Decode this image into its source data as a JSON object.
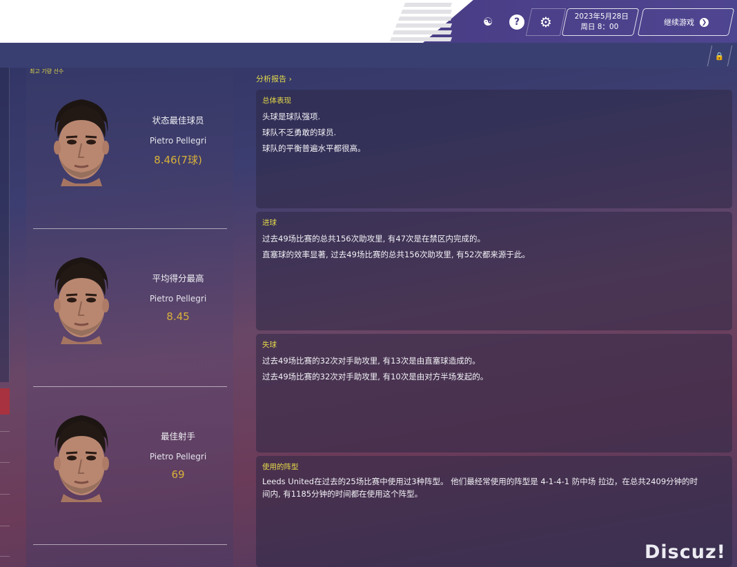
{
  "header": {
    "date": "2023年5月28日",
    "time": "周日 8：00",
    "continue_label": "继续游戏",
    "icons": [
      "globe-icon",
      "help-icon",
      "gear-icon",
      "lock-icon",
      "chevron-right-icon"
    ]
  },
  "players_panel": {
    "title": "최고 기량 선수",
    "cards": [
      {
        "title": "状态最佳球员",
        "name": "Pietro Pellegri",
        "value": "8.46(7球)"
      },
      {
        "title": "平均得分最高",
        "name": "Pietro Pellegri",
        "value": "8.45"
      },
      {
        "title": "最佳射手",
        "name": "Pietro Pellegri",
        "value": "69"
      }
    ]
  },
  "analysis": {
    "link_label": "分析报告",
    "sections": [
      {
        "title": "总体表现",
        "lines": [
          "头球是球队强项.",
          "球队不乏勇敢的球员.",
          "球队的平衡普遍水平都很高。"
        ]
      },
      {
        "title": "进球",
        "lines": [
          "过去49场比赛的总共156次助攻里, 有47次是在禁区内完成的。",
          "直塞球的效率显著, 过去49场比赛的总共156次助攻里, 有52次都来源于此。"
        ]
      },
      {
        "title": "失球",
        "lines": [
          "过去49场比赛的32次对手助攻里, 有13次是由直塞球造成的。",
          "过去49场比赛的32次对手助攻里, 有10次是由对方半场发起的。"
        ]
      },
      {
        "title": "使用的阵型",
        "paragraph": "Leeds United在过去的25场比赛中使用过3种阵型。 他们最经常使用的阵型是 4-1-4-1 防中场 拉边，在总共2409分钟的时间内, 有1185分钟的时间都在使用这个阵型。"
      }
    ]
  },
  "watermark": "Discuz!",
  "colors": {
    "accent_yellow": "#e4d94a",
    "value_gold": "#d9b13a",
    "header_purple": "#4a3d86"
  }
}
